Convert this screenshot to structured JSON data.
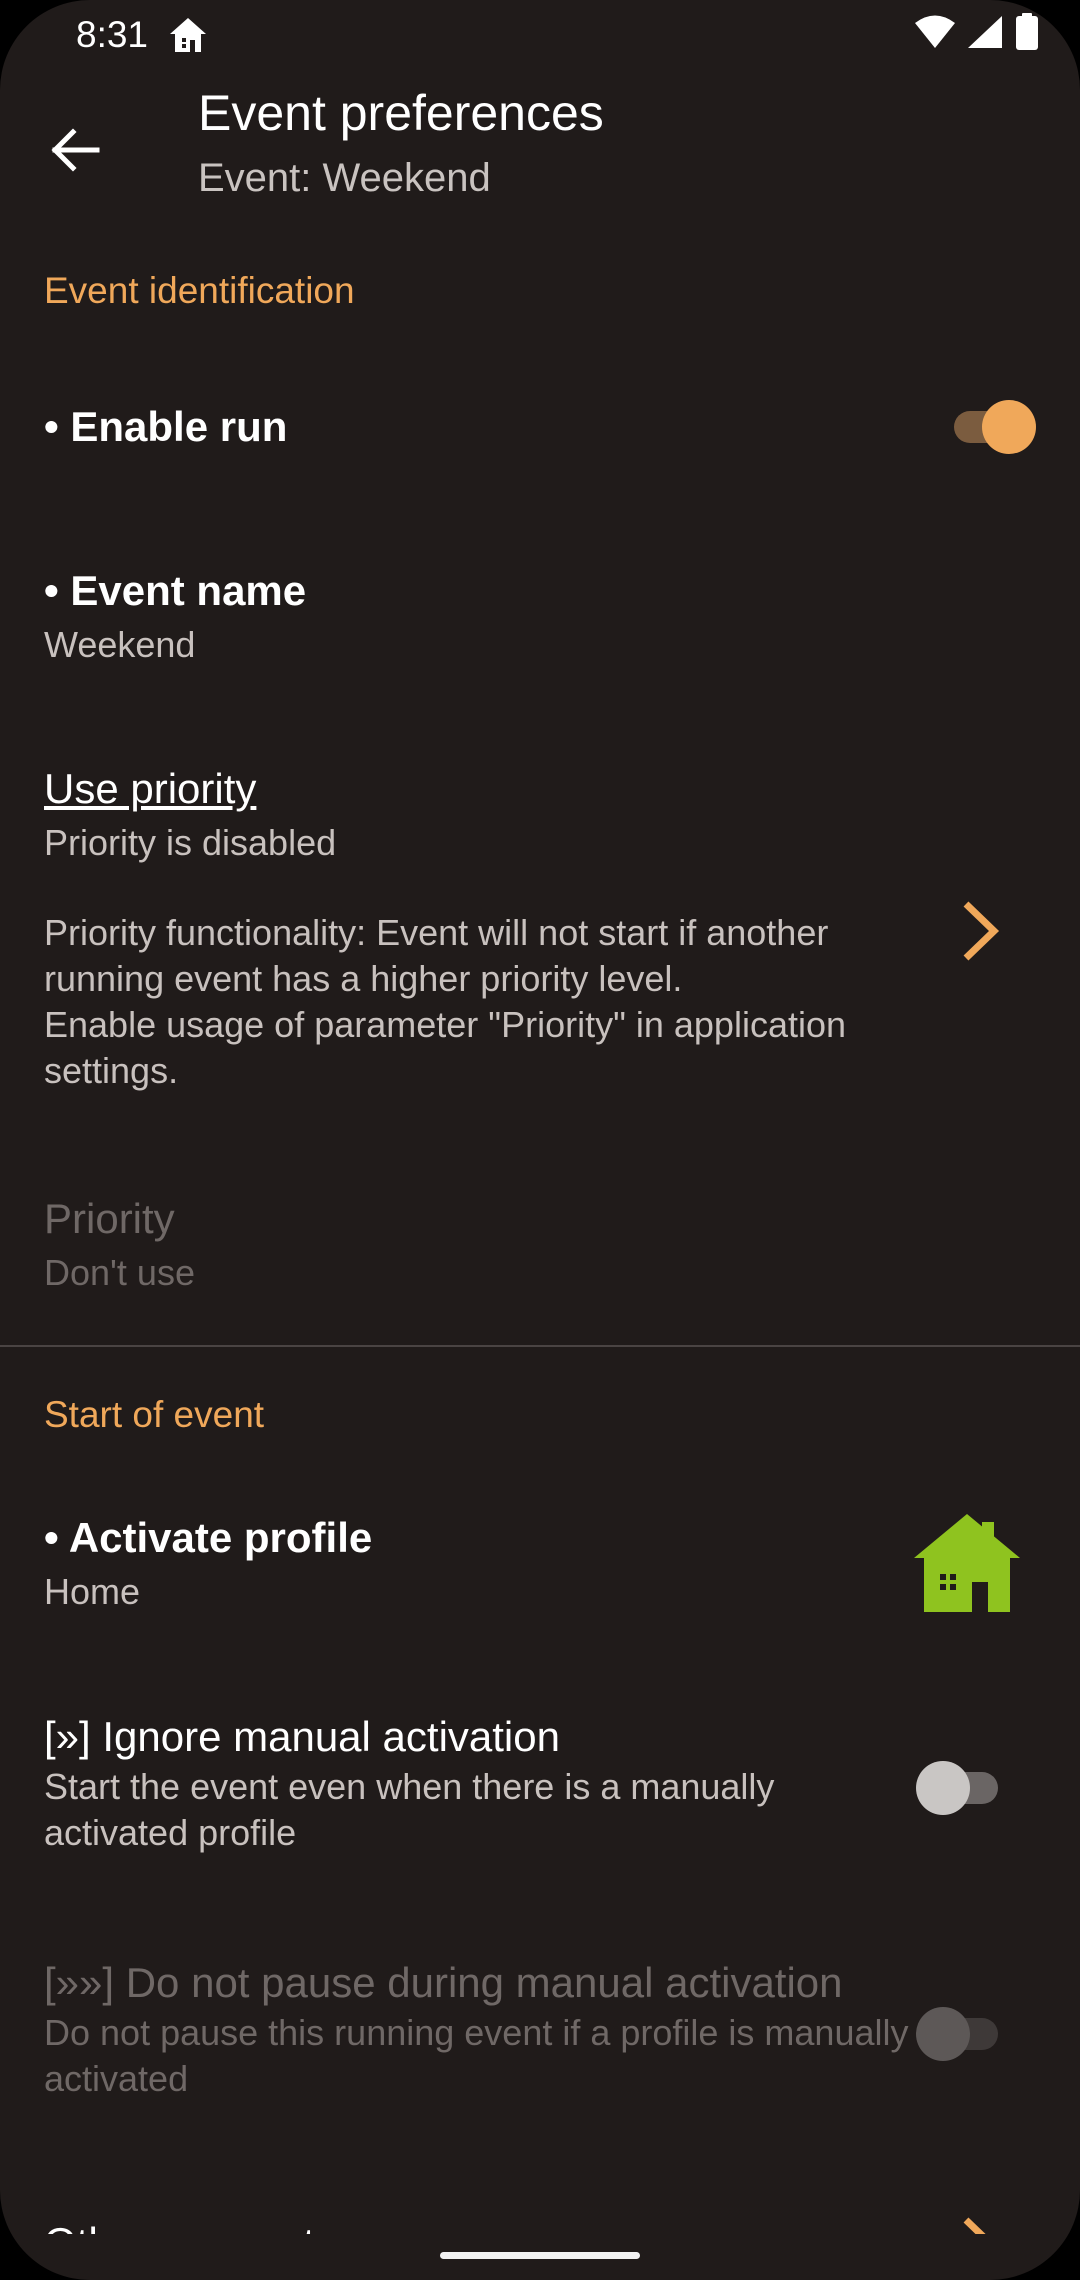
{
  "status": {
    "time": "8:31"
  },
  "header": {
    "title": "Event preferences",
    "subtitle": "Event: Weekend"
  },
  "sections": {
    "identification": "Event identification",
    "start": "Start of event"
  },
  "prefs": {
    "enable_run": {
      "title": "• Enable run",
      "checked": true
    },
    "event_name": {
      "title": "• Event name",
      "summary": "Weekend"
    },
    "use_priority": {
      "title": "Use priority",
      "summary1": "Priority is disabled",
      "summary2": "Priority functionality: Event will not start if another running event has a higher priority level.",
      "summary3": "Enable usage of parameter \"Priority\" in application settings."
    },
    "priority": {
      "title": "Priority",
      "summary": "Don't use"
    },
    "activate_profile": {
      "title": "• Activate profile",
      "summary": "Home",
      "icon": "home-profile-icon"
    },
    "ignore_manual": {
      "title": "[»] Ignore manual activation",
      "summary": "Start the event even when there is a manually activated profile",
      "checked": false
    },
    "no_pause": {
      "title": "[»»] Do not pause during manual activation",
      "summary": "Do not pause this running event if a profile is manually activated",
      "checked": false
    },
    "others": {
      "title": "Other parameters"
    }
  },
  "colors": {
    "accent": "#f0a85a",
    "background": "#201b1a",
    "profile_icon": "#8fc31f"
  }
}
